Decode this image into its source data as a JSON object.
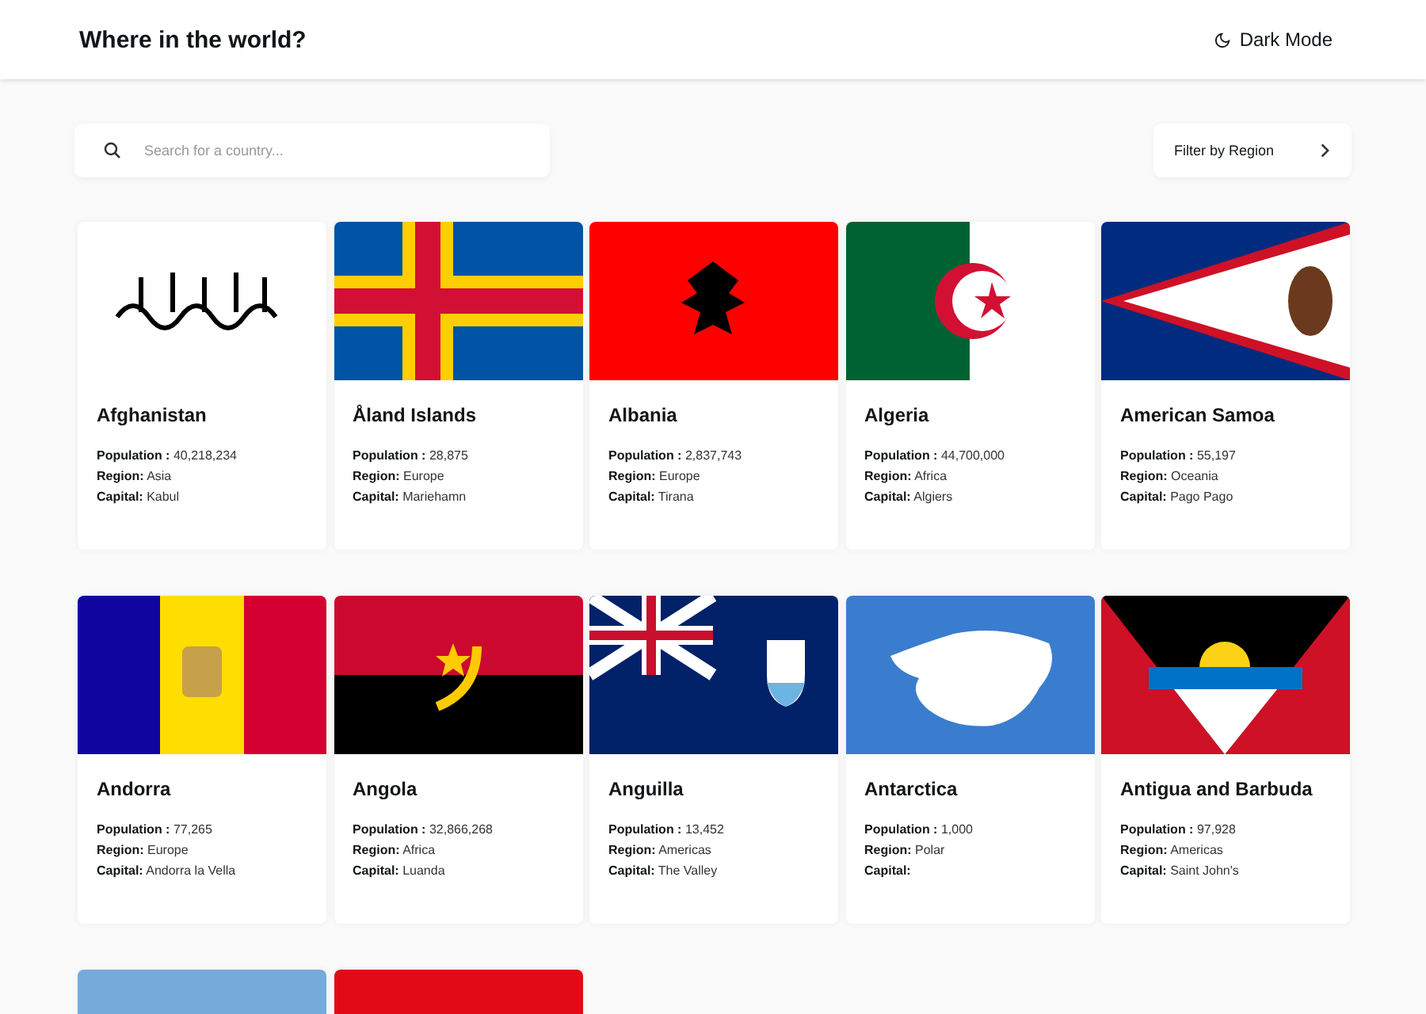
{
  "header": {
    "title": "Where in the world?",
    "theme_toggle": "Dark Mode"
  },
  "search": {
    "placeholder": "Search for a country..."
  },
  "filter": {
    "label": "Filter by Region"
  },
  "countries": [
    {
      "kind": "full",
      "name": "Afghanistan",
      "population_label": "Population :",
      "population": "40,218,234",
      "region_label": "Region:",
      "region": "Asia",
      "capital_label": "Capital:",
      "capital": "Kabul"
    },
    {
      "kind": "full",
      "name": "Åland Islands",
      "population_label": "Population :",
      "population": "28,875",
      "region_label": "Region:",
      "region": "Europe",
      "capital_label": "Capital:",
      "capital": "Mariehamn"
    },
    {
      "kind": "full",
      "name": "Albania",
      "population_label": "Population :",
      "population": "2,837,743",
      "region_label": "Region:",
      "region": "Europe",
      "capital_label": "Capital:",
      "capital": "Tirana"
    },
    {
      "kind": "full",
      "name": "Algeria",
      "population_label": "Population :",
      "population": "44,700,000",
      "region_label": "Region:",
      "region": "Africa",
      "capital_label": "Capital:",
      "capital": "Algiers"
    },
    {
      "kind": "full",
      "name": "American Samoa",
      "population_label": "Population :",
      "population": "55,197",
      "region_label": "Region:",
      "region": "Oceania",
      "capital_label": "Capital:",
      "capital": "Pago Pago"
    },
    {
      "kind": "full",
      "name": "Andorra",
      "population_label": "Population :",
      "population": "77,265",
      "region_label": "Region:",
      "region": "Europe",
      "capital_label": "Capital:",
      "capital": "Andorra la Vella"
    },
    {
      "kind": "full",
      "name": "Angola",
      "population_label": "Population :",
      "population": "32,866,268",
      "region_label": "Region:",
      "region": "Africa",
      "capital_label": "Capital:",
      "capital": "Luanda"
    },
    {
      "kind": "full",
      "name": "Anguilla",
      "population_label": "Population :",
      "population": "13,452",
      "region_label": "Region:",
      "region": "Americas",
      "capital_label": "Capital:",
      "capital": "The Valley"
    },
    {
      "kind": "full",
      "name": "Antarctica",
      "population_label": "Population :",
      "population": "1,000",
      "region_label": "Region:",
      "region": "Polar",
      "capital_label": "Capital:"
    },
    {
      "kind": "full",
      "name": "Antigua and Barbuda",
      "population_label": "Population :",
      "population": "97,928",
      "region_label": "Region:",
      "region": "Americas",
      "capital_label": "Capital:",
      "capital": "Saint John's"
    },
    {
      "kind": "flag-only"
    },
    {
      "kind": "flag-only"
    }
  ]
}
